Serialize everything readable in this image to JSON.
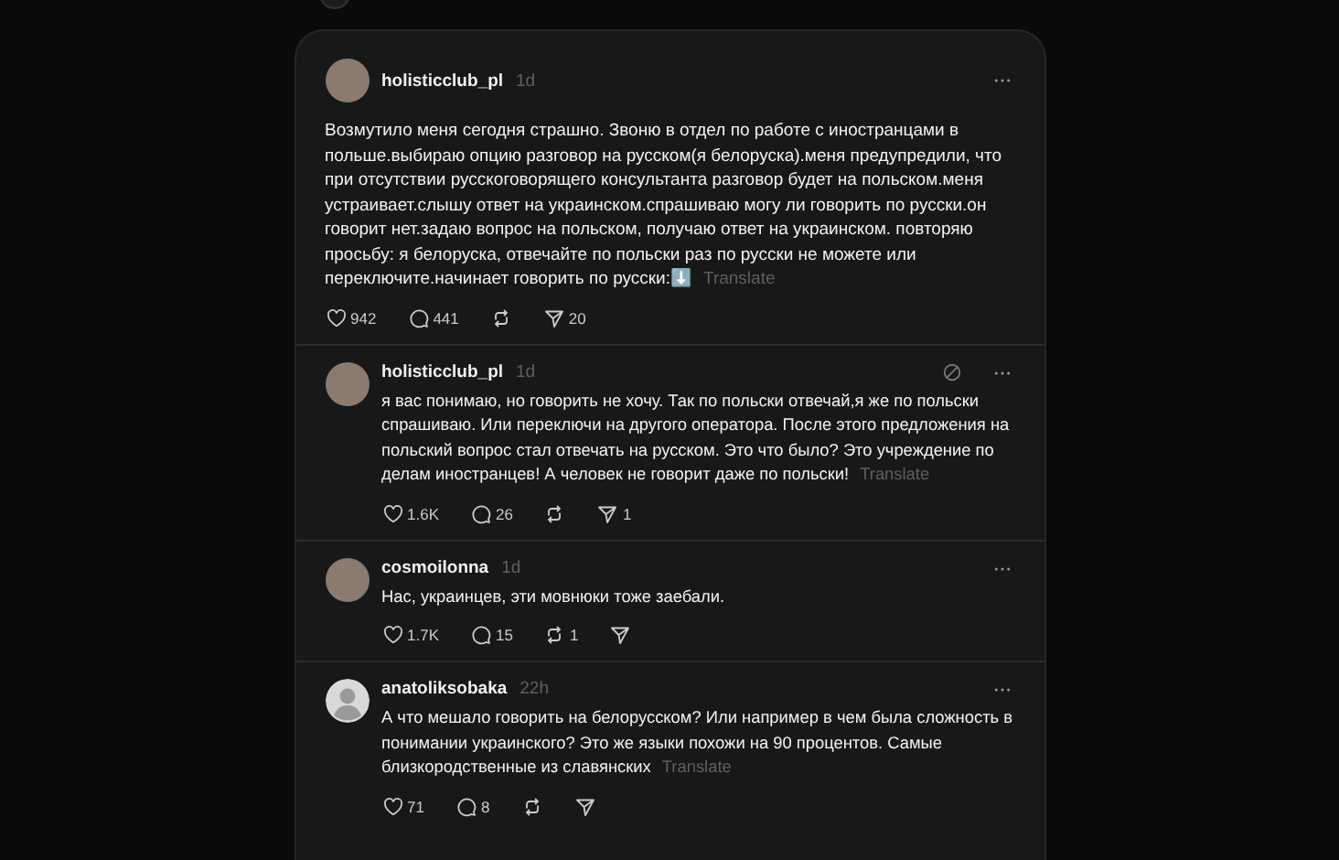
{
  "posts": [
    {
      "kind": "root",
      "has_photo": true,
      "username": "holisticclub_pl",
      "time": "1d",
      "hidden_indicator": false,
      "text": "Возмутило меня сегодня страшно. Звоню в отдел по работе с иностранцами в польше.выбираю опцию разговор на русском(я белоруска).меня предупредили, что при отсутствии русскоговорящего консультанта разговор будет на польском.меня устраивает.слышу ответ на украинском.спрашиваю могу ли говорить по русски.он говорит нет.задаю вопрос на польском, получаю ответ на украинском. повторяю просьбу: я белоруска, отвечайте по польски раз по русски не можете или переключите.начинает говорить по русски:⬇️",
      "translate": "Translate",
      "likes": "942",
      "replies": "441",
      "share": "20"
    },
    {
      "kind": "reply",
      "has_photo": true,
      "username": "holisticclub_pl",
      "time": "1d",
      "hidden_indicator": true,
      "text": "я вас понимаю, но говорить не хочу. Так по польски отвечай,я же по польски спрашиваю. Или переключи на другого оператора. После этого предложения на польский вопрос стал отвечать на русском. Это что было? Это учреждение по делам иностранцев! А человек не говорит даже по польски!",
      "translate": "Translate",
      "likes": "1.6K",
      "replies": "26",
      "share": "1"
    },
    {
      "kind": "reply",
      "has_photo": true,
      "username": "cosmoilonna",
      "time": "1d",
      "hidden_indicator": false,
      "text": "Нас, украинцев, эти мовнюки тоже заебали.",
      "likes": "1.7K",
      "replies": "15",
      "reposts": "1"
    },
    {
      "kind": "reply",
      "has_photo": false,
      "username": "anatoliksobaka",
      "time": "22h",
      "hidden_indicator": false,
      "text": "А что мешало говорить на белорусском? Или например в чем была сложность в понимании украинского? Это же языки похожи на 90 процентов. Самые близкородственные из славянских",
      "translate": "Translate",
      "likes": "71",
      "replies": "8"
    }
  ]
}
